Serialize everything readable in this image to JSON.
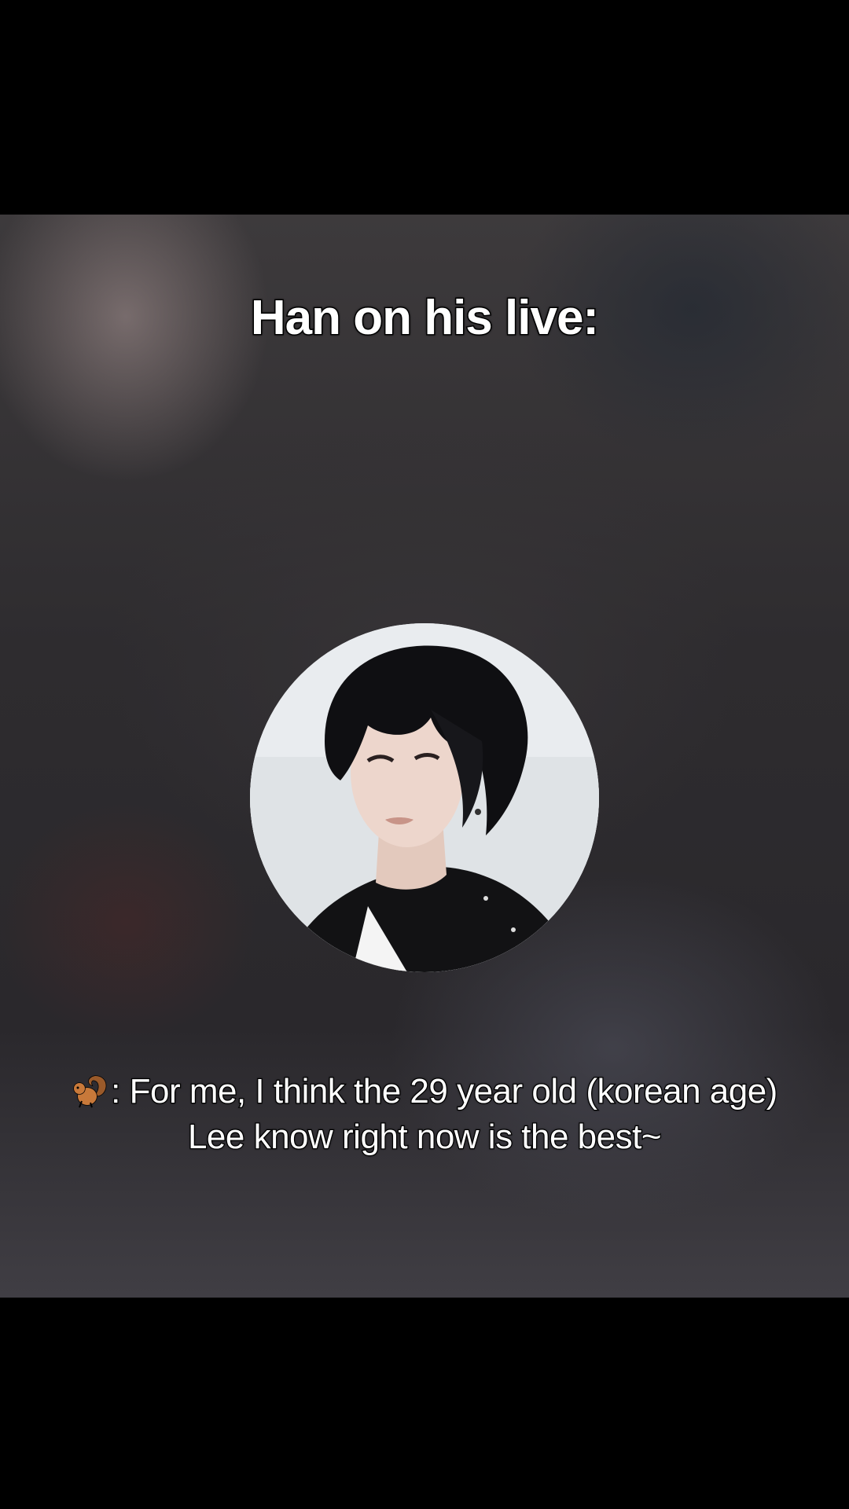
{
  "overlay": {
    "title": "Han on his live:"
  },
  "avatar": {
    "icon": "profile-photo"
  },
  "caption": {
    "speaker_icon": "chipmunk-icon",
    "line1": ": For me, I think the 29 year old (korean age)",
    "line2": "Lee know right now is the best~"
  },
  "colors": {
    "letterbox": "#000000",
    "text": "#ffffff",
    "text_outline": "#000000"
  }
}
